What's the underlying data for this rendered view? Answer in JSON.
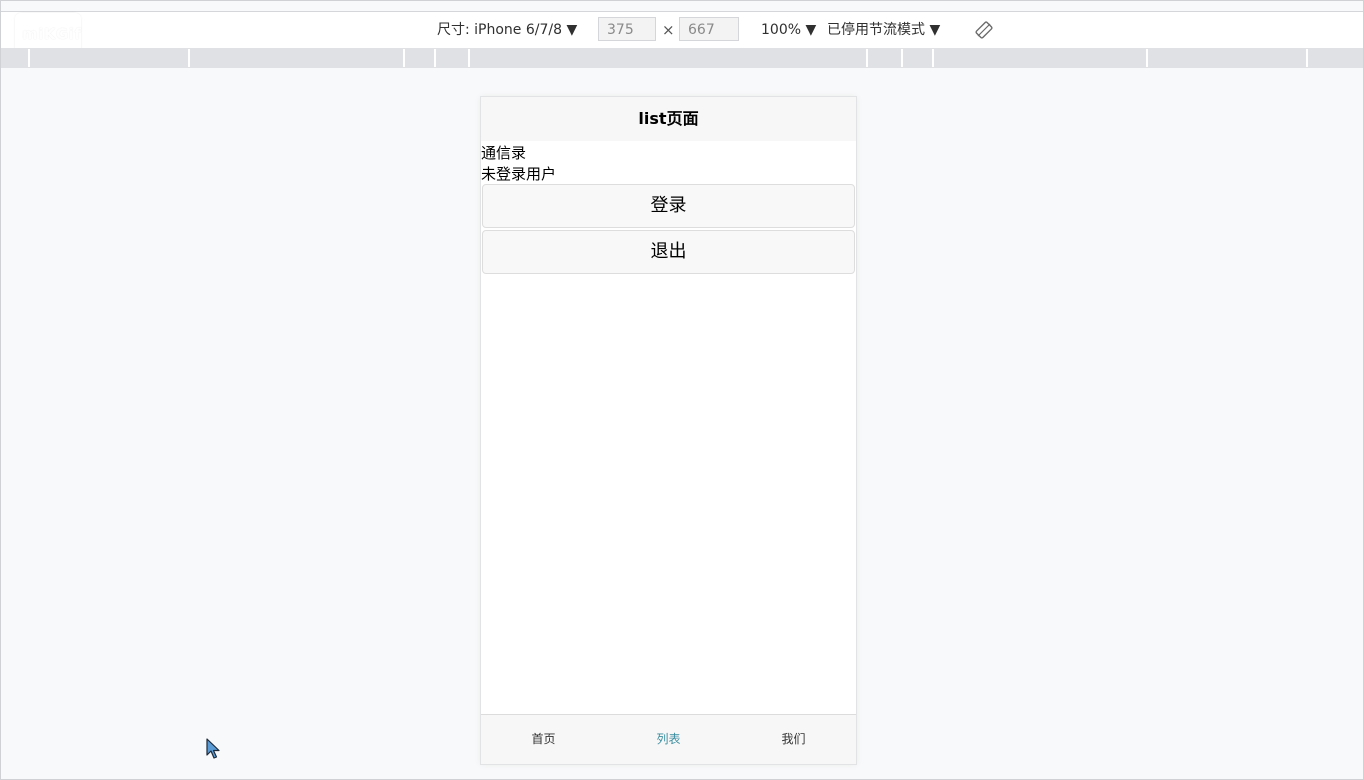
{
  "devtools": {
    "device_label": "尺寸: iPhone 6/7/8 ▼",
    "width_value": "375",
    "times": "×",
    "height_value": "667",
    "zoom_label": "100% ▼",
    "throttle_label": "已停用节流模式 ▼",
    "rotate_icon": "rotate-icon"
  },
  "logo_text": "miKGif",
  "page": {
    "nav_title": "list页面",
    "contacts_heading": "通信录",
    "user_status": "未登录用户",
    "login_button": "登录",
    "logout_button": "退出"
  },
  "tabbar": {
    "items": [
      {
        "label": "首页",
        "active": false
      },
      {
        "label": "列表",
        "active": true
      },
      {
        "label": "我们",
        "active": false
      }
    ],
    "active_color": "#3b8ea0"
  }
}
